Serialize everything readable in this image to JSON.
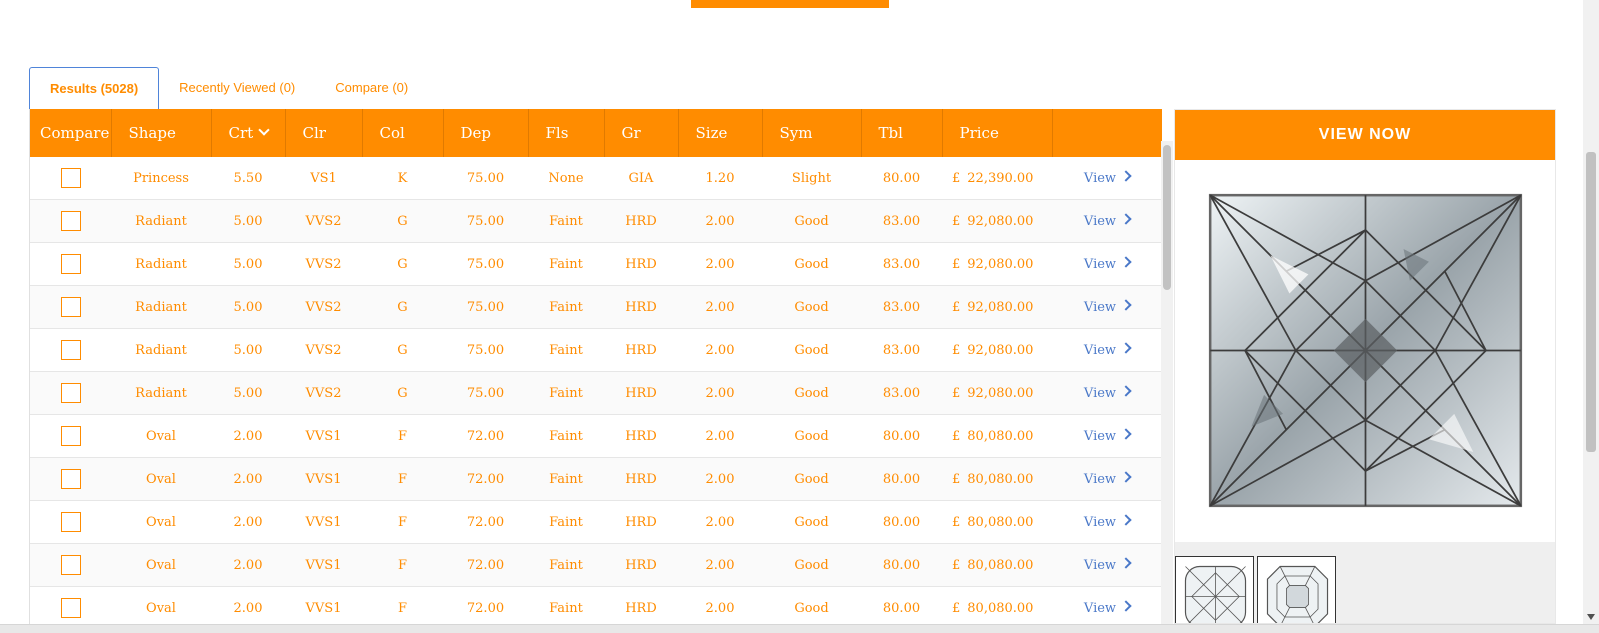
{
  "tabs": [
    {
      "label": "Results (5028)",
      "active": true
    },
    {
      "label": "Recently Viewed (0)",
      "active": false
    },
    {
      "label": "Compare (0)",
      "active": false
    }
  ],
  "columns": [
    "Compare",
    "Shape",
    "Crt",
    "Clr",
    "Col",
    "Dep",
    "Fls",
    "Gr",
    "Size",
    "Sym",
    "Tbl",
    "Price",
    ""
  ],
  "sorted_column": "Crt",
  "currency_symbol": "£",
  "view_label": "View",
  "rows": [
    {
      "shape": "Princess",
      "crt": "5.50",
      "clr": "VS1",
      "col": "K",
      "dep": "75.00",
      "fls": "None",
      "gr": "GIA",
      "size": "1.20",
      "sym": "Slight",
      "tbl": "80.00",
      "price": "22,390.00"
    },
    {
      "shape": "Radiant",
      "crt": "5.00",
      "clr": "VVS2",
      "col": "G",
      "dep": "75.00",
      "fls": "Faint",
      "gr": "HRD",
      "size": "2.00",
      "sym": "Good",
      "tbl": "83.00",
      "price": "92,080.00"
    },
    {
      "shape": "Radiant",
      "crt": "5.00",
      "clr": "VVS2",
      "col": "G",
      "dep": "75.00",
      "fls": "Faint",
      "gr": "HRD",
      "size": "2.00",
      "sym": "Good",
      "tbl": "83.00",
      "price": "92,080.00"
    },
    {
      "shape": "Radiant",
      "crt": "5.00",
      "clr": "VVS2",
      "col": "G",
      "dep": "75.00",
      "fls": "Faint",
      "gr": "HRD",
      "size": "2.00",
      "sym": "Good",
      "tbl": "83.00",
      "price": "92,080.00"
    },
    {
      "shape": "Radiant",
      "crt": "5.00",
      "clr": "VVS2",
      "col": "G",
      "dep": "75.00",
      "fls": "Faint",
      "gr": "HRD",
      "size": "2.00",
      "sym": "Good",
      "tbl": "83.00",
      "price": "92,080.00"
    },
    {
      "shape": "Radiant",
      "crt": "5.00",
      "clr": "VVS2",
      "col": "G",
      "dep": "75.00",
      "fls": "Faint",
      "gr": "HRD",
      "size": "2.00",
      "sym": "Good",
      "tbl": "83.00",
      "price": "92,080.00"
    },
    {
      "shape": "Oval",
      "crt": "2.00",
      "clr": "VVS1",
      "col": "F",
      "dep": "72.00",
      "fls": "Faint",
      "gr": "HRD",
      "size": "2.00",
      "sym": "Good",
      "tbl": "80.00",
      "price": "80,080.00"
    },
    {
      "shape": "Oval",
      "crt": "2.00",
      "clr": "VVS1",
      "col": "F",
      "dep": "72.00",
      "fls": "Faint",
      "gr": "HRD",
      "size": "2.00",
      "sym": "Good",
      "tbl": "80.00",
      "price": "80,080.00"
    },
    {
      "shape": "Oval",
      "crt": "2.00",
      "clr": "VVS1",
      "col": "F",
      "dep": "72.00",
      "fls": "Faint",
      "gr": "HRD",
      "size": "2.00",
      "sym": "Good",
      "tbl": "80.00",
      "price": "80,080.00"
    },
    {
      "shape": "Oval",
      "crt": "2.00",
      "clr": "VVS1",
      "col": "F",
      "dep": "72.00",
      "fls": "Faint",
      "gr": "HRD",
      "size": "2.00",
      "sym": "Good",
      "tbl": "80.00",
      "price": "80,080.00"
    },
    {
      "shape": "Oval",
      "crt": "2.00",
      "clr": "VVS1",
      "col": "F",
      "dep": "72.00",
      "fls": "Faint",
      "gr": "HRD",
      "size": "2.00",
      "sym": "Good",
      "tbl": "80.00",
      "price": "80,080.00"
    }
  ],
  "side_panel": {
    "button_label": "VIEW NOW",
    "main_image": "princess-diamond-icon",
    "thumbnails": [
      "cushion-diamond-icon",
      "asscher-diamond-icon"
    ]
  },
  "colors": {
    "accent": "#ff8c00",
    "link": "#4a78c8",
    "tab_border": "#4f84d9"
  }
}
